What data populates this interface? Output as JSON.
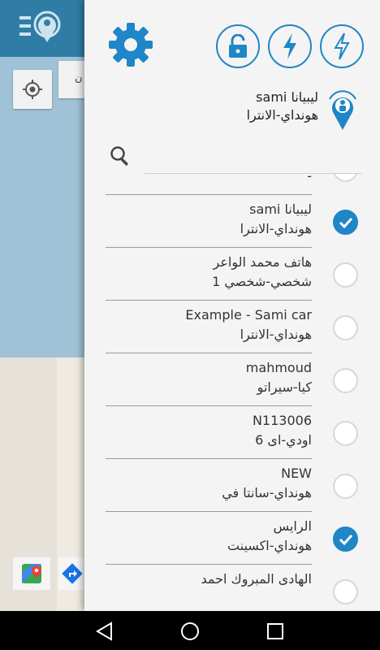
{
  "colors": {
    "accent": "#1f86c7",
    "app_bar": "#2f7da5",
    "drawer_bg": "#f4f4f4"
  },
  "map_overlay": {
    "peek_text": "ن"
  },
  "drawer": {
    "toolbar": {
      "settings_icon": "gear-icon",
      "buttons": [
        {
          "icon": "lock-open-icon"
        },
        {
          "icon": "lightning-icon"
        },
        {
          "icon": "lightning-outline-icon"
        }
      ]
    },
    "current_vehicle": {
      "name": "sami ليبيانا",
      "model": "هونداي-الانترا",
      "icon": "location-pin-person-icon"
    },
    "search": {
      "placeholder": "",
      "value": ""
    },
    "vehicles": [
      {
        "name": "",
        "model": "-",
        "checked": false
      },
      {
        "name": "sami ليبيانا",
        "model": "هونداي-الانترا",
        "checked": true
      },
      {
        "name": "هاتف محمد الواعر",
        "model": "شخصي-شخصي 1",
        "checked": false
      },
      {
        "name": "Example - Sami car",
        "model": "هونداي-الانترا",
        "checked": false
      },
      {
        "name": "mahmoud",
        "model": "كيا-سيراتو",
        "checked": false
      },
      {
        "name": "N113006",
        "model": "اودي-اى 6",
        "checked": false
      },
      {
        "name": "NEW",
        "model": "هونداي-سانتا في",
        "checked": false
      },
      {
        "name": "الرايس",
        "model": "هونداي-اكسينت",
        "checked": true
      },
      {
        "name": "الهادى المبروك احمد",
        "model": "",
        "checked": false
      }
    ]
  },
  "navbar": {
    "back": "back-icon",
    "home": "home-icon",
    "recents": "recents-icon"
  }
}
